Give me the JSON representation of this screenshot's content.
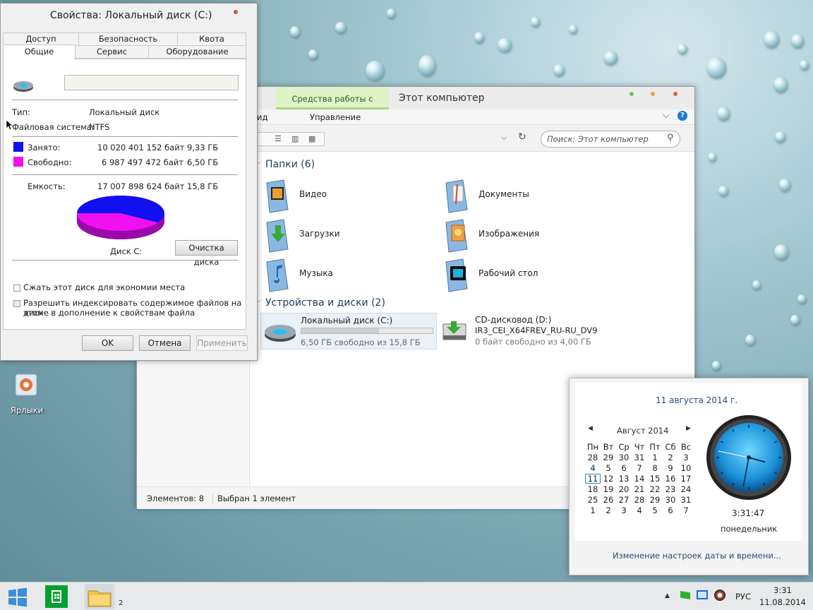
{
  "desktop": {
    "icon_label": "Ярлыки"
  },
  "props": {
    "title": "Свойства: Локальный диск (C:)",
    "tabs_row1": [
      "Доступ",
      "Безопасность",
      "Квота"
    ],
    "tabs_row2": [
      "Общие",
      "Сервис",
      "Оборудование"
    ],
    "type_label": "Тип:",
    "type_value": "Локальный диск",
    "fs_label": "Файловая система:",
    "fs_value": "NTFS",
    "used_label": "Занято:",
    "used_bytes": "10 020 401 152 байт",
    "used_gb": "9,33 ГБ",
    "free_label": "Свободно:",
    "free_bytes": "6 987 497 472 байт",
    "free_gb": "6,50 ГБ",
    "cap_label": "Емкость:",
    "cap_bytes": "17 007 898 624 байт",
    "cap_gb": "15,8 ГБ",
    "used_fraction": 0.589,
    "used_color": "#1010f0",
    "free_color": "#f010f0",
    "disk_label": "Диск C:",
    "cleanup": "Очистка диска",
    "compress": "Сжать этот диск для экономии места",
    "index_line1": "Разрешить индексировать содержимое файлов на этом",
    "index_line2": "диске в дополнение к свойствам файла",
    "ok": "OK",
    "cancel": "Отмена",
    "apply": "Применить"
  },
  "explorer": {
    "tools_tab": "Средства работы с дисками",
    "title": "Этот компьютер",
    "ribbon_left": "ид",
    "ribbon_manage": "Управление",
    "search_placeholder": "Поиск: Этот компьютер",
    "folders_header": "Папки (6)",
    "folders": [
      {
        "label": "Видео"
      },
      {
        "label": "Документы"
      },
      {
        "label": "Загрузки"
      },
      {
        "label": "Изображения"
      },
      {
        "label": "Музыка"
      },
      {
        "label": "Рабочий стол"
      }
    ],
    "devices_header": "Устройства и диски (2)",
    "drive_c": {
      "name": "Локальный диск (C:)",
      "free": "6,50 ГБ свободно из 15,8 ГБ",
      "used_fraction": 0.589
    },
    "drive_d": {
      "name": "CD-дисковод (D:)",
      "label": "IR3_CEI_X64FREV_RU-RU_DV9",
      "free": "0 байт свободно из 4,00 ГБ"
    },
    "status_items": "Элементов: 8",
    "status_selected": "Выбран 1 элемент"
  },
  "clock": {
    "date": "11 августа 2014 г.",
    "month": "Август 2014",
    "weekdays": [
      "Пн",
      "Вт",
      "Ср",
      "Чт",
      "Пт",
      "Сб",
      "Вс"
    ],
    "days": [
      "28",
      "29",
      "30",
      "31",
      "1",
      "2",
      "3",
      "4",
      "5",
      "6",
      "7",
      "8",
      "9",
      "10",
      "11",
      "12",
      "13",
      "14",
      "15",
      "16",
      "17",
      "18",
      "19",
      "20",
      "21",
      "22",
      "23",
      "24",
      "25",
      "26",
      "27",
      "28",
      "29",
      "30",
      "31",
      "1",
      "2",
      "3",
      "4",
      "5",
      "6",
      "7"
    ],
    "today": "11",
    "time": "3:31:47",
    "weekday": "понедельник",
    "settings_link": "Изменение настроек даты и времени...",
    "accent": "#1a8fd8"
  },
  "taskbar": {
    "badge": "2",
    "lang": "РУС",
    "time": "3:31",
    "date": "11.08.2014"
  }
}
